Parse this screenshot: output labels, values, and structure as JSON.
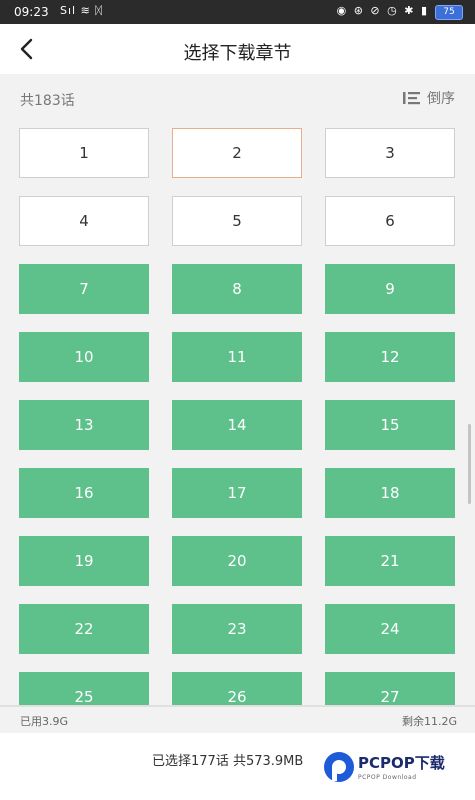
{
  "status_bar": {
    "time": "09:23",
    "signal_text": "Sıl ≋ ᛞ",
    "right_icons_text": "◉ ⊛ ⊘ ◷ ✱ ▮",
    "battery": "75"
  },
  "header": {
    "title": "选择下载章节",
    "back_icon": "chevron-left-icon"
  },
  "subheader": {
    "count": "共183话",
    "sort_label": "倒序",
    "sort_icon": "sort-order-icon"
  },
  "chapters": [
    {
      "num": "1",
      "state": "free"
    },
    {
      "num": "2",
      "state": "selected"
    },
    {
      "num": "3",
      "state": "free"
    },
    {
      "num": "4",
      "state": "free"
    },
    {
      "num": "5",
      "state": "free"
    },
    {
      "num": "6",
      "state": "free"
    },
    {
      "num": "7",
      "state": "downloaded"
    },
    {
      "num": "8",
      "state": "downloaded"
    },
    {
      "num": "9",
      "state": "downloaded"
    },
    {
      "num": "10",
      "state": "downloaded"
    },
    {
      "num": "11",
      "state": "downloaded"
    },
    {
      "num": "12",
      "state": "downloaded"
    },
    {
      "num": "13",
      "state": "downloaded"
    },
    {
      "num": "14",
      "state": "downloaded"
    },
    {
      "num": "15",
      "state": "downloaded"
    },
    {
      "num": "16",
      "state": "downloaded"
    },
    {
      "num": "17",
      "state": "downloaded"
    },
    {
      "num": "18",
      "state": "downloaded"
    },
    {
      "num": "19",
      "state": "downloaded"
    },
    {
      "num": "20",
      "state": "downloaded"
    },
    {
      "num": "21",
      "state": "downloaded"
    },
    {
      "num": "22",
      "state": "downloaded"
    },
    {
      "num": "23",
      "state": "downloaded"
    },
    {
      "num": "24",
      "state": "downloaded"
    },
    {
      "num": "25",
      "state": "downloaded"
    },
    {
      "num": "26",
      "state": "downloaded"
    },
    {
      "num": "27",
      "state": "downloaded"
    }
  ],
  "storage": {
    "used": "已用3.9G",
    "remaining": "剩余11.2G"
  },
  "bottom": {
    "summary": "已选择177话 共573.9MB"
  },
  "watermark": {
    "brand": "PCPOP下载",
    "sub": "PCPOP Download"
  },
  "colors": {
    "downloaded": "#5ec08b",
    "selected_border": "#e8b08a",
    "status_bar": "#2b2b2b"
  }
}
